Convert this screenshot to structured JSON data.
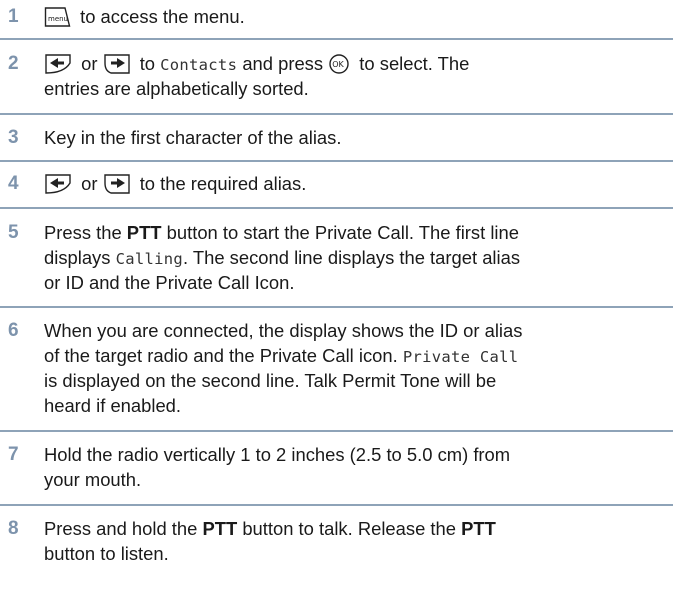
{
  "steps": [
    {
      "number": "1",
      "text_after_menu": " to access the menu.",
      "menu_key_label": "menu"
    },
    {
      "number": "2",
      "or": " or ",
      "to": " to ",
      "contacts": "Contacts",
      "and_press": " and press ",
      "to_select": " to select. The",
      "line2": "entries are alphabetically sorted.",
      "ok_label": "OK"
    },
    {
      "number": "3",
      "text": "Key in the first character of the alias."
    },
    {
      "number": "4",
      "or": " or ",
      "text_after": " to the required alias."
    },
    {
      "number": "5",
      "l1_a": "Press the ",
      "ptt": "PTT",
      "l1_b": " button to start the Private Call. The first line",
      "l2_a": "displays ",
      "calling": "Calling",
      "l2_b": ". The second line displays the target alias",
      "l3": "or ID and the Private Call Icon."
    },
    {
      "number": "6",
      "l1": "When you are connected, the display shows the ID or alias",
      "l2_a": "of the target radio and the Private Call icon. ",
      "private_call": "Private Call",
      "l3": "is displayed on the second line. Talk Permit Tone will be",
      "l4": "heard if enabled."
    },
    {
      "number": "7",
      "l1": "Hold the radio vertically 1 to 2 inches (2.5 to 5.0 cm) from",
      "l2": "your mouth."
    },
    {
      "number": "8",
      "l1_a": "Press and hold the ",
      "ptt": "PTT",
      "l1_b": " button to talk. Release the ",
      "ptt2": "PTT",
      "l2": "button to listen."
    }
  ],
  "colors": {
    "step_number": "#7d93ac",
    "separator": "#8ea3b8",
    "text": "#1a1a1a"
  },
  "icons": [
    "menu-key-icon",
    "left-arrow-key-icon",
    "right-arrow-key-icon",
    "ok-key-icon"
  ]
}
